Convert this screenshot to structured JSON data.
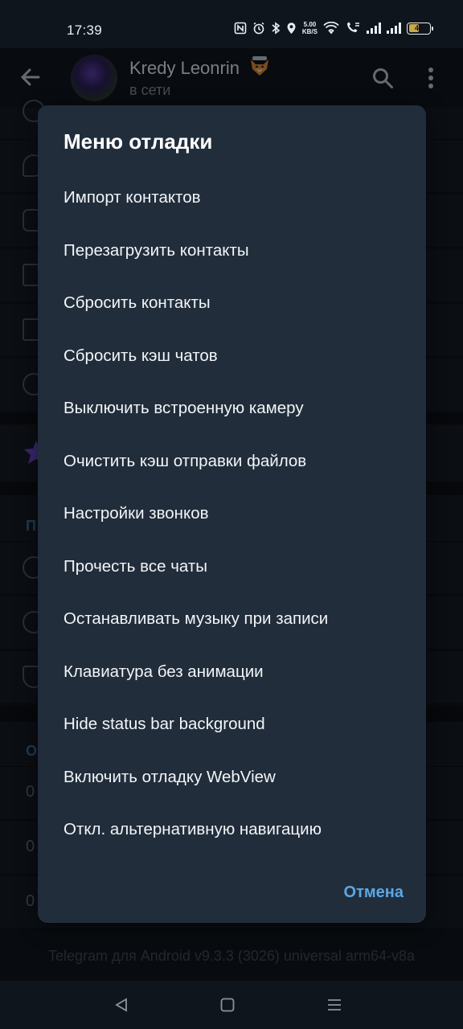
{
  "status_bar": {
    "time": "17:39",
    "net_speed_value": "5.00",
    "net_speed_unit": "KB/S",
    "battery_level": "48"
  },
  "header": {
    "chat_name": "Kredy Leonrin",
    "chat_status": "в сети"
  },
  "dialog": {
    "title": "Меню отладки",
    "items": [
      "Импорт контактов",
      "Перезагрузить контакты",
      "Сбросить контакты",
      "Сбросить кэш чатов",
      "Выключить встроенную камеру",
      "Очистить кэш отправки файлов",
      "Настройки звонков",
      "Прочесть все чаты",
      "Останавливать музыку при записи",
      "Клавиатура без анимации",
      "Hide status bar background",
      "Включить отладку WebView",
      "Откл. альтернативную навигацию"
    ],
    "cancel_label": "Отмена"
  },
  "background": {
    "section_letter_1": "П",
    "section_letter_2": "О",
    "zero_1": "0",
    "zero_2": "0",
    "zero_3": "0"
  },
  "footer": {
    "version": "Telegram для Android v9.3.3 (3026) universal arm64-v8a"
  },
  "colors": {
    "dialog_bg": "#212d3b",
    "accent": "#5aa7e6",
    "app_bg": "#0f151c"
  }
}
